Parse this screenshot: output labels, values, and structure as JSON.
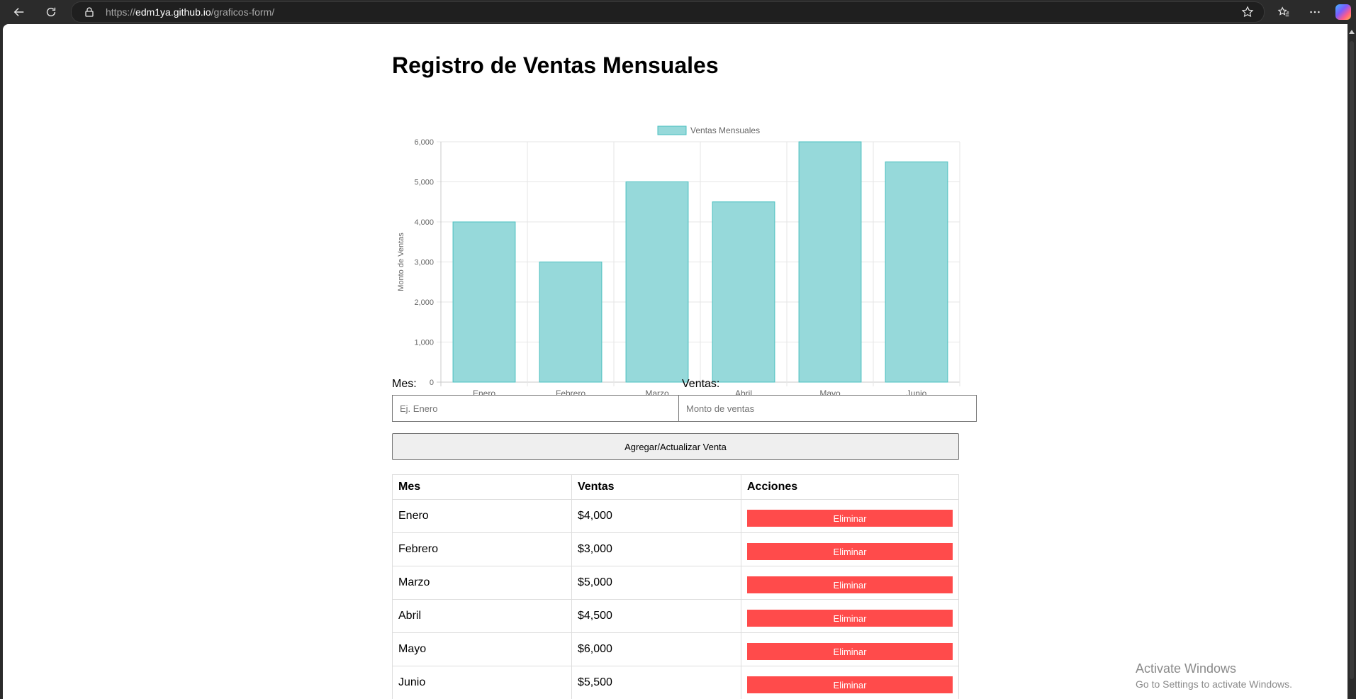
{
  "browser": {
    "url_scheme": "https://",
    "url_host": "edm1ya.github.io",
    "url_path": "/graficos-form/"
  },
  "page": {
    "title": "Registro de Ventas Mensuales"
  },
  "chart_data": {
    "type": "bar",
    "categories": [
      "Enero",
      "Febrero",
      "Marzo",
      "Abril",
      "Mayo",
      "Junio"
    ],
    "series": [
      {
        "name": "Ventas Mensuales",
        "values": [
          4000,
          3000,
          5000,
          4500,
          6000,
          5500
        ]
      }
    ],
    "ylabel": "Monto de Ventas",
    "xlabel": "",
    "ylim": [
      0,
      6000
    ],
    "yticks": [
      "0",
      "1,000",
      "2,000",
      "3,000",
      "4,000",
      "5,000",
      "6,000"
    ],
    "legend_position": "top",
    "grid": true,
    "bar_color": "#96d9da",
    "bar_border_color": "#4bc0c0"
  },
  "form": {
    "mes_label": "Mes:",
    "mes_placeholder": "Ej. Enero",
    "ventas_label": "Ventas:",
    "ventas_placeholder": "Monto de ventas",
    "submit_label": "Agregar/Actualizar Venta"
  },
  "table": {
    "headers": [
      "Mes",
      "Ventas",
      "Acciones"
    ],
    "rows": [
      {
        "mes": "Enero",
        "ventas": "$4,000",
        "action": "Eliminar"
      },
      {
        "mes": "Febrero",
        "ventas": "$3,000",
        "action": "Eliminar"
      },
      {
        "mes": "Marzo",
        "ventas": "$5,000",
        "action": "Eliminar"
      },
      {
        "mes": "Abril",
        "ventas": "$4,500",
        "action": "Eliminar"
      },
      {
        "mes": "Mayo",
        "ventas": "$6,000",
        "action": "Eliminar"
      },
      {
        "mes": "Junio",
        "ventas": "$5,500",
        "action": "Eliminar"
      }
    ],
    "delete_color": "#ff4b4b"
  },
  "watermark": {
    "line1": "Activate Windows",
    "line2": "Go to Settings to activate Windows."
  }
}
